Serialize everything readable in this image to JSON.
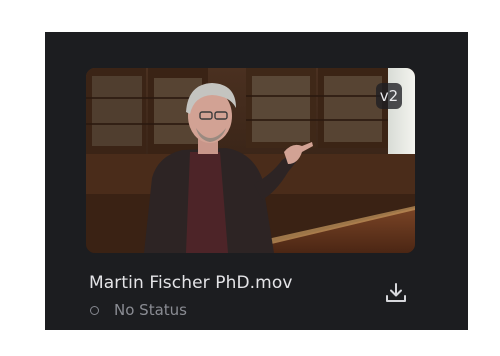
{
  "card": {
    "version_label": "v2",
    "file_name": "Martin Fischer PhD.mov",
    "status_label": "No Status",
    "thumbnail_alt": "video thumbnail",
    "download_icon": "download-icon",
    "status_icon": "status-circle-icon"
  },
  "colors": {
    "card_background": "#1c1d20",
    "title_text": "#e4e4e7",
    "status_text": "#8a8c93",
    "badge_background": "#1e1e22"
  }
}
